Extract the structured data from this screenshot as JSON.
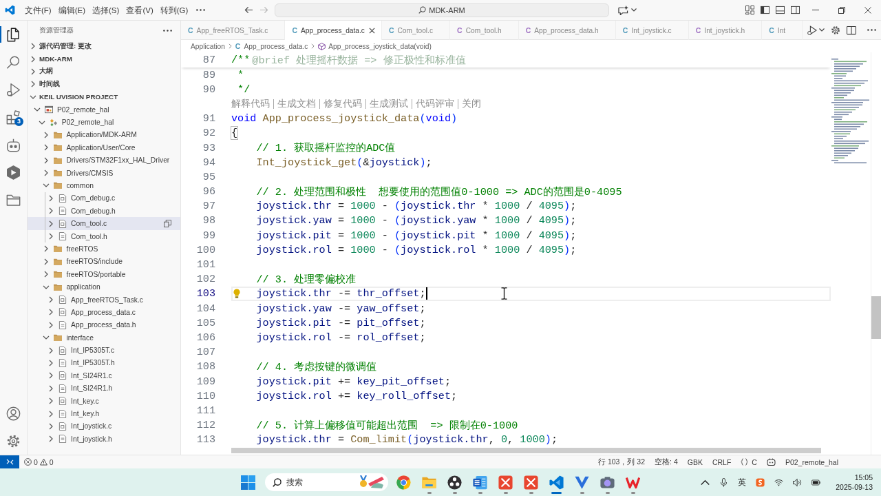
{
  "title_bar": {
    "menu": [
      "文件(F)",
      "编辑(E)",
      "选择(S)",
      "查看(V)",
      "转到(G)"
    ],
    "command_center": "MDK-ARM",
    "layout_toggles": [
      {
        "kind": "sidebar",
        "on": true
      },
      {
        "kind": "panel",
        "on": false
      },
      {
        "kind": "secondary",
        "on": false
      }
    ]
  },
  "activity_bar": {
    "items": [
      {
        "kind": "explorer",
        "selected": true
      },
      {
        "kind": "search",
        "selected": false
      },
      {
        "kind": "debug",
        "selected": false
      },
      {
        "kind": "extensions",
        "selected": false,
        "badge": "3"
      },
      {
        "kind": "robot",
        "selected": false
      },
      {
        "kind": "hexagon",
        "selected": false
      },
      {
        "kind": "folder",
        "selected": false
      }
    ],
    "bottom": [
      {
        "kind": "account"
      },
      {
        "kind": "settings"
      }
    ]
  },
  "sidebar": {
    "title": "资源管理器",
    "sections": [
      {
        "label": "源代码管理: 更改",
        "expanded": false
      },
      {
        "label": "MDK-ARM",
        "expanded": false
      },
      {
        "label": "大纲",
        "expanded": false
      },
      {
        "label": "时间线",
        "expanded": false
      },
      {
        "label": "KEIL UVISION PROJECT",
        "expanded": true,
        "tree": [
          {
            "label": "P02_remote_hal",
            "kind": "project",
            "expanded": true,
            "selected": false,
            "children": [
              {
                "label": "P02_remote_hal",
                "kind": "target",
                "expanded": true,
                "selected": false,
                "children": [
                  {
                    "label": "Application/MDK-ARM",
                    "kind": "folder",
                    "expanded": false,
                    "selected": false
                  },
                  {
                    "label": "Application/User/Core",
                    "kind": "folder",
                    "expanded": false,
                    "selected": false
                  },
                  {
                    "label": "Drivers/STM32F1xx_HAL_Driver",
                    "kind": "folder",
                    "expanded": false,
                    "selected": false
                  },
                  {
                    "label": "Drivers/CMSIS",
                    "kind": "folder",
                    "expanded": false,
                    "selected": false
                  },
                  {
                    "label": "common",
                    "kind": "folder",
                    "expanded": true,
                    "selected": false,
                    "children": [
                      {
                        "label": "Com_debug.c",
                        "kind": "source",
                        "expanded": false,
                        "selected": false
                      },
                      {
                        "label": "Com_debug.h",
                        "kind": "header",
                        "expanded": false,
                        "selected": false
                      },
                      {
                        "label": "Com_tool.c",
                        "kind": "source",
                        "expanded": false,
                        "selected": true
                      },
                      {
                        "label": "Com_tool.h",
                        "kind": "header",
                        "expanded": false,
                        "selected": false
                      }
                    ]
                  },
                  {
                    "label": "freeRTOS",
                    "kind": "folder",
                    "expanded": false,
                    "selected": false
                  },
                  {
                    "label": "freeRTOS/include",
                    "kind": "folder",
                    "expanded": false,
                    "selected": false
                  },
                  {
                    "label": "freeRTOS/portable",
                    "kind": "folder",
                    "expanded": false,
                    "selected": false
                  },
                  {
                    "label": "application",
                    "kind": "folder",
                    "expanded": true,
                    "selected": false,
                    "children": [
                      {
                        "label": "App_freeRTOS_Task.c",
                        "kind": "source",
                        "expanded": false,
                        "selected": false
                      },
                      {
                        "label": "App_process_data.c",
                        "kind": "source",
                        "expanded": false,
                        "selected": false
                      },
                      {
                        "label": "App_process_data.h",
                        "kind": "header",
                        "expanded": false,
                        "selected": false
                      }
                    ]
                  },
                  {
                    "label": "interface",
                    "kind": "folder",
                    "expanded": true,
                    "selected": false,
                    "children": [
                      {
                        "label": "Int_IP5305T.c",
                        "kind": "source",
                        "expanded": false,
                        "selected": false
                      },
                      {
                        "label": "Int_IP5305T.h",
                        "kind": "header",
                        "expanded": false,
                        "selected": false
                      },
                      {
                        "label": "Int_SI24R1.c",
                        "kind": "source",
                        "expanded": false,
                        "selected": false
                      },
                      {
                        "label": "Int_SI24R1.h",
                        "kind": "header",
                        "expanded": false,
                        "selected": false
                      },
                      {
                        "label": "Int_key.c",
                        "kind": "source",
                        "expanded": false,
                        "selected": false
                      },
                      {
                        "label": "Int_key.h",
                        "kind": "header",
                        "expanded": false,
                        "selected": false
                      },
                      {
                        "label": "Int_joystick.c",
                        "kind": "source",
                        "expanded": false,
                        "selected": false
                      },
                      {
                        "label": "Int_joystick.h",
                        "kind": "header",
                        "expanded": false,
                        "selected": false
                      }
                    ]
                  }
                ]
              }
            ]
          }
        ]
      }
    ]
  },
  "editor": {
    "tabs": [
      {
        "icon": "C",
        "label": "App_freeRTOS_Task.c",
        "kind": "source",
        "selected": false
      },
      {
        "icon": "C",
        "label": "App_process_data.c",
        "kind": "source",
        "selected": true
      },
      {
        "icon": "C",
        "label": "Com_tool.c",
        "kind": "source",
        "selected": false
      },
      {
        "icon": "C",
        "label": "Com_tool.h",
        "kind": "header",
        "selected": false
      },
      {
        "icon": "C",
        "label": "App_process_data.h",
        "kind": "header",
        "selected": false
      },
      {
        "icon": "C",
        "label": "Int_joystick.c",
        "kind": "source",
        "selected": false
      },
      {
        "icon": "C",
        "label": "Int_joystick.h",
        "kind": "header",
        "selected": false
      },
      {
        "icon": "C",
        "label": "Int",
        "kind": "source",
        "selected": false
      }
    ],
    "breadcrumb": [
      {
        "kind": "folder",
        "label": "Application"
      },
      {
        "kind": "source",
        "icon": "C",
        "label": "App_process_data.c"
      },
      {
        "kind": "function",
        "label": "App_process_joystick_data(void)"
      }
    ],
    "sticky": {
      "number": "87",
      "code": "/**",
      "ghost": "@brief 处理摇杆数据 => 修正极性和标准值"
    },
    "lines": [
      {
        "kind": "code",
        "number": "89",
        "current": false,
        "tokens": [
          {
            "kind": "comment",
            "text": " *"
          }
        ]
      },
      {
        "kind": "code",
        "number": "90",
        "current": false,
        "tokens": [
          {
            "kind": "comment",
            "text": " */"
          }
        ]
      },
      {
        "kind": "codelens",
        "actions": [
          "解释代码",
          "生成文档",
          "修复代码",
          "生成测试",
          "代码评审",
          "关闭"
        ]
      },
      {
        "kind": "code",
        "number": "91",
        "current": false,
        "tokens": [
          {
            "kind": "keyword",
            "text": "void "
          },
          {
            "kind": "function",
            "text": "App_process_joystick_data"
          },
          {
            "kind": "bracket",
            "text": "("
          },
          {
            "kind": "keyword",
            "text": "void"
          },
          {
            "kind": "bracket",
            "text": ")"
          }
        ]
      },
      {
        "kind": "code",
        "number": "92",
        "current": false,
        "tokens": [
          {
            "kind": "brace",
            "text": "{"
          }
        ],
        "children": [
          {
            "kind": "code",
            "number": "93",
            "current": false,
            "tokens": [
              {
                "kind": "comment",
                "text": "// 1. 获取摇杆监控的ADC值"
              }
            ]
          },
          {
            "kind": "code",
            "number": "94",
            "current": false,
            "tokens": [
              {
                "kind": "function",
                "text": "Int_joystick_get"
              },
              {
                "kind": "bracket",
                "text": "("
              },
              {
                "kind": "plain",
                "text": "&"
              },
              {
                "kind": "variable",
                "text": "joystick"
              },
              {
                "kind": "bracket",
                "text": ")"
              },
              {
                "kind": "plain",
                "text": ";"
              }
            ]
          },
          {
            "kind": "code",
            "number": "95",
            "current": false
          },
          {
            "kind": "code",
            "number": "96",
            "current": false,
            "tokens": [
              {
                "kind": "comment",
                "text": "// 2. 处理范围和极性  想要使用的范围值0-1000 => ADC的范围是0-4095"
              }
            ]
          },
          {
            "kind": "code",
            "number": "97",
            "current": false,
            "tokens": [
              {
                "kind": "variable",
                "text": "joystick.thr"
              },
              {
                "kind": "plain",
                "text": " = "
              },
              {
                "kind": "number",
                "text": "1000"
              },
              {
                "kind": "plain",
                "text": " - "
              },
              {
                "kind": "bracket",
                "text": "("
              },
              {
                "kind": "variable",
                "text": "joystick.thr"
              },
              {
                "kind": "plain",
                "text": " * "
              },
              {
                "kind": "number",
                "text": "1000"
              },
              {
                "kind": "plain",
                "text": " / "
              },
              {
                "kind": "number",
                "text": "4095"
              },
              {
                "kind": "bracket",
                "text": ")"
              },
              {
                "kind": "plain",
                "text": ";"
              }
            ]
          },
          {
            "kind": "code",
            "number": "98",
            "current": false,
            "tokens": [
              {
                "kind": "variable",
                "text": "joystick.yaw"
              },
              {
                "kind": "plain",
                "text": " = "
              },
              {
                "kind": "number",
                "text": "1000"
              },
              {
                "kind": "plain",
                "text": " - "
              },
              {
                "kind": "bracket",
                "text": "("
              },
              {
                "kind": "variable",
                "text": "joystick.yaw"
              },
              {
                "kind": "plain",
                "text": " * "
              },
              {
                "kind": "number",
                "text": "1000"
              },
              {
                "kind": "plain",
                "text": " / "
              },
              {
                "kind": "number",
                "text": "4095"
              },
              {
                "kind": "bracket",
                "text": ")"
              },
              {
                "kind": "plain",
                "text": ";"
              }
            ]
          },
          {
            "kind": "code",
            "number": "99",
            "current": false,
            "tokens": [
              {
                "kind": "variable",
                "text": "joystick.pit"
              },
              {
                "kind": "plain",
                "text": " = "
              },
              {
                "kind": "number",
                "text": "1000"
              },
              {
                "kind": "plain",
                "text": " - "
              },
              {
                "kind": "bracket",
                "text": "("
              },
              {
                "kind": "variable",
                "text": "joystick.pit"
              },
              {
                "kind": "plain",
                "text": " * "
              },
              {
                "kind": "number",
                "text": "1000"
              },
              {
                "kind": "plain",
                "text": " / "
              },
              {
                "kind": "number",
                "text": "4095"
              },
              {
                "kind": "bracket",
                "text": ")"
              },
              {
                "kind": "plain",
                "text": ";"
              }
            ]
          },
          {
            "kind": "code",
            "number": "100",
            "current": false,
            "tokens": [
              {
                "kind": "variable",
                "text": "joystick.rol"
              },
              {
                "kind": "plain",
                "text": " = "
              },
              {
                "kind": "number",
                "text": "1000"
              },
              {
                "kind": "plain",
                "text": " - "
              },
              {
                "kind": "bracket",
                "text": "("
              },
              {
                "kind": "variable",
                "text": "joystick.rol"
              },
              {
                "kind": "plain",
                "text": " * "
              },
              {
                "kind": "number",
                "text": "1000"
              },
              {
                "kind": "plain",
                "text": " / "
              },
              {
                "kind": "number",
                "text": "4095"
              },
              {
                "kind": "bracket",
                "text": ")"
              },
              {
                "kind": "plain",
                "text": ";"
              }
            ]
          },
          {
            "kind": "code",
            "number": "101",
            "current": false
          },
          {
            "kind": "code",
            "number": "102",
            "current": false,
            "tokens": [
              {
                "kind": "comment",
                "text": "// 3. 处理零偏校准"
              }
            ]
          },
          {
            "kind": "code",
            "number": "103",
            "current": true,
            "tokens": [
              {
                "kind": "variable",
                "text": "joystick.thr"
              },
              {
                "kind": "plain",
                "text": " -= "
              },
              {
                "kind": "variable",
                "text": "thr_offset"
              },
              {
                "kind": "plain",
                "text": ";"
              }
            ]
          },
          {
            "kind": "code",
            "number": "104",
            "current": false,
            "tokens": [
              {
                "kind": "variable",
                "text": "joystick.yaw"
              },
              {
                "kind": "plain",
                "text": " -= "
              },
              {
                "kind": "variable",
                "text": "yaw_offset"
              },
              {
                "kind": "plain",
                "text": ";"
              }
            ]
          },
          {
            "kind": "code",
            "number": "105",
            "current": false,
            "tokens": [
              {
                "kind": "variable",
                "text": "joystick.pit"
              },
              {
                "kind": "plain",
                "text": " -= "
              },
              {
                "kind": "variable",
                "text": "pit_offset"
              },
              {
                "kind": "plain",
                "text": ";"
              }
            ]
          },
          {
            "kind": "code",
            "number": "106",
            "current": false,
            "tokens": [
              {
                "kind": "variable",
                "text": "joystick.rol"
              },
              {
                "kind": "plain",
                "text": " -= "
              },
              {
                "kind": "variable",
                "text": "rol_offset"
              },
              {
                "kind": "plain",
                "text": ";"
              }
            ]
          },
          {
            "kind": "code",
            "number": "107",
            "current": false
          },
          {
            "kind": "code",
            "number": "108",
            "current": false,
            "tokens": [
              {
                "kind": "comment",
                "text": "// 4. 考虑按键的微调值"
              }
            ]
          },
          {
            "kind": "code",
            "number": "109",
            "current": false,
            "tokens": [
              {
                "kind": "variable",
                "text": "joystick.pit"
              },
              {
                "kind": "plain",
                "text": " += "
              },
              {
                "kind": "variable",
                "text": "key_pit_offset"
              },
              {
                "kind": "plain",
                "text": ";"
              }
            ]
          },
          {
            "kind": "code",
            "number": "110",
            "current": false,
            "tokens": [
              {
                "kind": "variable",
                "text": "joystick.rol"
              },
              {
                "kind": "plain",
                "text": " += "
              },
              {
                "kind": "variable",
                "text": "key_roll_offset"
              },
              {
                "kind": "plain",
                "text": ";"
              }
            ]
          },
          {
            "kind": "code",
            "number": "111",
            "current": false
          },
          {
            "kind": "code",
            "number": "112",
            "current": false,
            "tokens": [
              {
                "kind": "comment",
                "text": "// 5. 计算上偏移值可能超出范围  => 限制在0-1000"
              }
            ]
          },
          {
            "kind": "code",
            "number": "113",
            "current": false,
            "tokens": [
              {
                "kind": "variable",
                "text": "joystick.thr"
              },
              {
                "kind": "plain",
                "text": " = "
              },
              {
                "kind": "function",
                "text": "Com_limit"
              },
              {
                "kind": "bracket",
                "text": "("
              },
              {
                "kind": "variable",
                "text": "joystick.thr"
              },
              {
                "kind": "plain",
                "text": ", "
              },
              {
                "kind": "number",
                "text": "0"
              },
              {
                "kind": "plain",
                "text": ", "
              },
              {
                "kind": "number",
                "text": "1000"
              },
              {
                "kind": "bracket",
                "text": ")"
              },
              {
                "kind": "plain",
                "text": ";"
              }
            ]
          }
        ]
      }
    ]
  },
  "status_bar": {
    "errors": "0",
    "warnings": "0",
    "items": [
      "行 103，列 32",
      "空格: 4",
      "GBK",
      "CRLF"
    ],
    "language": "C",
    "project": "P02_remote_hal"
  },
  "taskbar": {
    "search": {
      "placeholder": "搜索"
    },
    "apps": [
      {
        "kind": "browser",
        "running": false,
        "active": false
      },
      {
        "kind": "files",
        "running": true,
        "active": false
      },
      {
        "kind": "recorder",
        "running": true,
        "active": false
      },
      {
        "kind": "word",
        "running": true,
        "active": false
      },
      {
        "kind": "mindmap",
        "running": true,
        "active": false
      },
      {
        "kind": "mindmap",
        "running": true,
        "active": false
      },
      {
        "kind": "editor",
        "running": true,
        "active": true
      },
      {
        "kind": "vee",
        "running": true,
        "active": false
      },
      {
        "kind": "camera",
        "running": true,
        "active": false
      },
      {
        "kind": "office",
        "running": true,
        "active": false
      }
    ],
    "tray": {
      "ime": "英",
      "time": "15:05",
      "date": "2025-09-13"
    }
  }
}
